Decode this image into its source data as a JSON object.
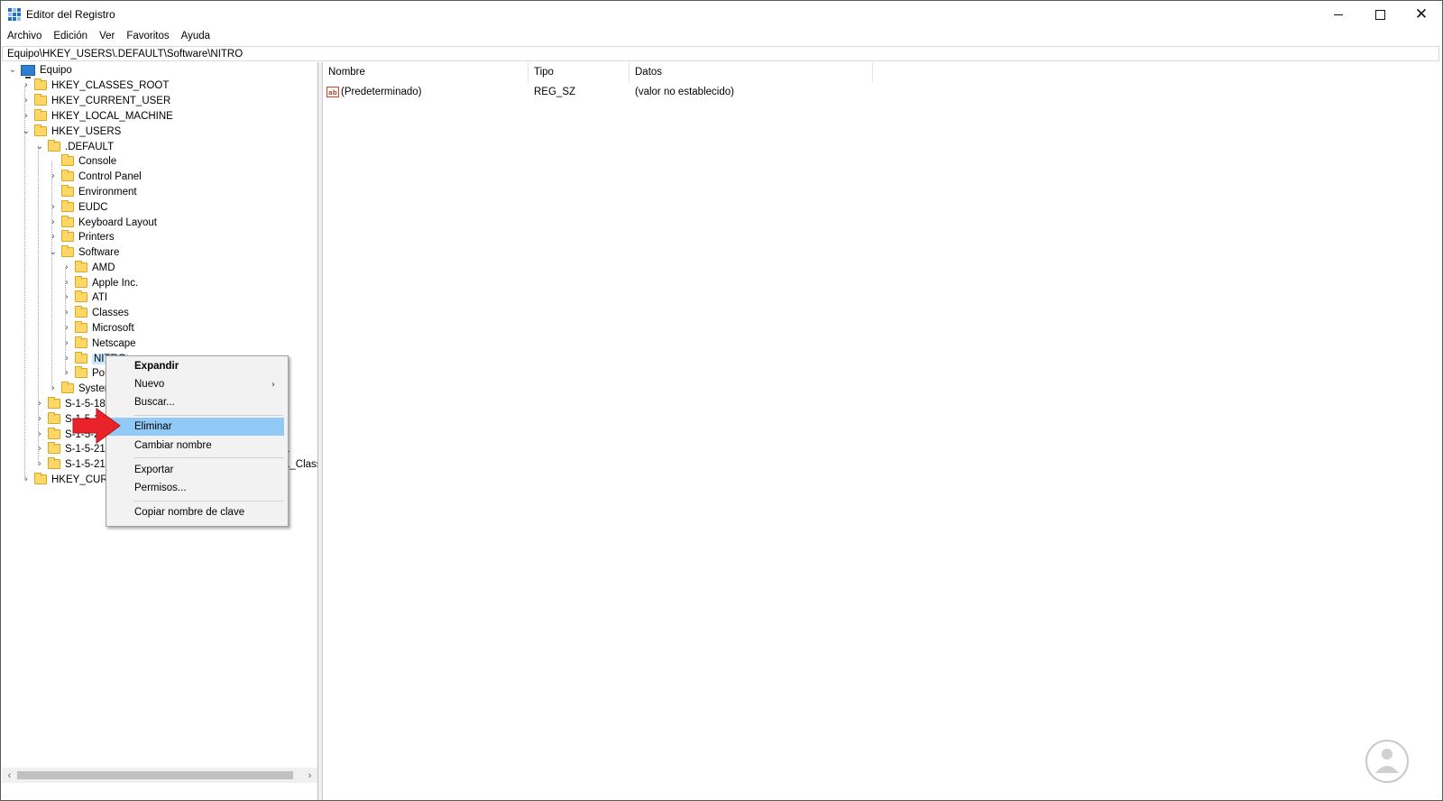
{
  "window": {
    "title": "Editor del Registro",
    "minimize_glyph": "",
    "close_glyph": "✕"
  },
  "menu": [
    "Archivo",
    "Edición",
    "Ver",
    "Favoritos",
    "Ayuda"
  ],
  "address": "Equipo\\HKEY_USERS\\.DEFAULT\\Software\\NITRO",
  "tree": [
    {
      "label": "Equipo",
      "icon": "computer-icon",
      "expander": "⌄"
    },
    {
      "label": "HKEY_CLASSES_ROOT",
      "expander": "›"
    },
    {
      "label": "HKEY_CURRENT_USER",
      "expander": "›"
    },
    {
      "label": "HKEY_LOCAL_MACHINE",
      "expander": "›"
    },
    {
      "label": "HKEY_USERS",
      "expander": "⌄"
    },
    {
      "label": ".DEFAULT",
      "expander": "⌄"
    },
    {
      "label": "Console",
      "expander": ""
    },
    {
      "label": "Control Panel",
      "expander": "›"
    },
    {
      "label": "Environment",
      "expander": ""
    },
    {
      "label": "EUDC",
      "expander": "›"
    },
    {
      "label": "Keyboard Layout",
      "expander": "›"
    },
    {
      "label": "Printers",
      "expander": "›"
    },
    {
      "label": "Software",
      "expander": "⌄"
    },
    {
      "label": "AMD",
      "expander": "›"
    },
    {
      "label": "Apple Inc.",
      "expander": "›"
    },
    {
      "label": "ATI",
      "expander": "›"
    },
    {
      "label": "Classes",
      "expander": "›"
    },
    {
      "label": "Microsoft",
      "expander": "›"
    },
    {
      "label": "Netscape",
      "expander": "›"
    },
    {
      "label": "NITRO",
      "expander": "›",
      "selected": true
    },
    {
      "label": "Policies",
      "expander": "›"
    },
    {
      "label": "System",
      "expander": "›"
    },
    {
      "label": "S-1-5-18",
      "expander": "›"
    },
    {
      "label": "S-1-5-19",
      "expander": "›"
    },
    {
      "label": "S-1-5-20",
      "expander": "›"
    },
    {
      "label": "S-1-5-21-",
      "expander": "›"
    },
    {
      "label": "S-1-5-21-",
      "expander": "›"
    },
    {
      "label": "HKEY_CURRENT_CONFIG",
      "expander": "›"
    }
  ],
  "tree_hidden_suffixes": [
    "1",
    "1_Class"
  ],
  "columns": [
    "Nombre",
    "Tipo",
    "Datos"
  ],
  "rows": [
    {
      "name": "(Predeterminado)",
      "type": "REG_SZ",
      "data": "(valor no establecido)",
      "icon_text": "ab"
    }
  ],
  "context_menu": {
    "items": [
      {
        "label": "Expandir",
        "bold": true
      },
      {
        "label": "Nuevo",
        "submenu": true
      },
      {
        "label": "Buscar..."
      },
      {
        "label": "Eliminar",
        "highlighted": true
      },
      {
        "label": "Cambiar nombre"
      },
      {
        "label": "Exportar"
      },
      {
        "label": "Permisos..."
      },
      {
        "label": "Copiar nombre de clave"
      }
    ],
    "submenu_glyph": "›"
  },
  "scrollbar": {
    "left_glyph": "‹",
    "right_glyph": "›"
  },
  "colors": {
    "selection": "#cce8ff",
    "menu_highlight": "#91c9f7",
    "arrow": "#e8232a",
    "folder": "#ffd767"
  }
}
